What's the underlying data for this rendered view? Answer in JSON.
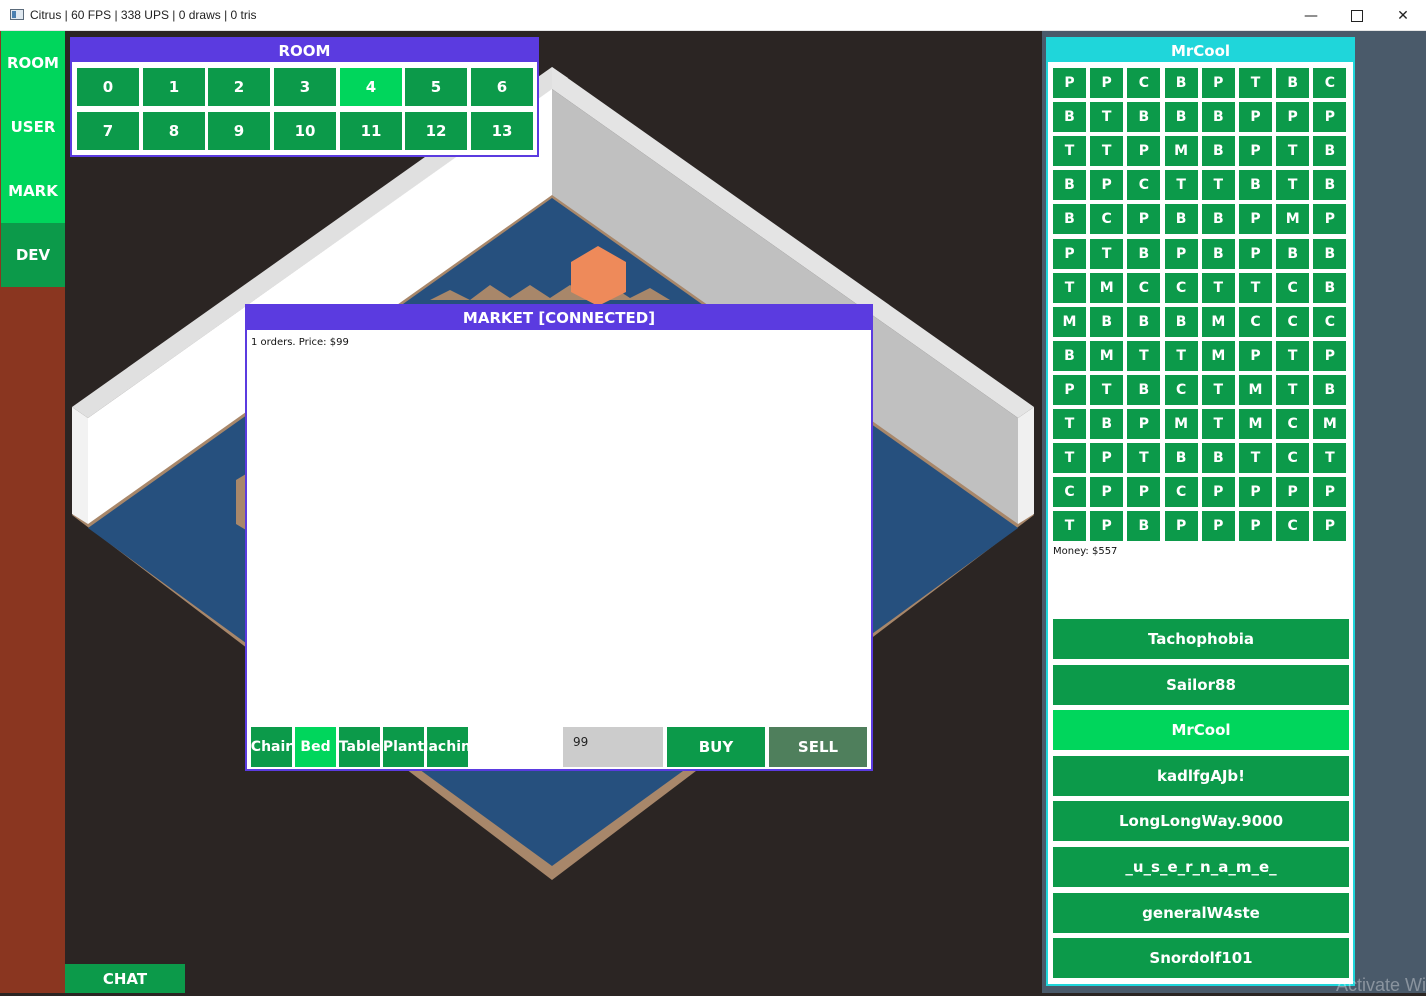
{
  "window": {
    "title": "Citrus | 60 FPS | 338 UPS | 0 draws | 0 tris"
  },
  "nav": {
    "items": [
      {
        "label": "ROOM"
      },
      {
        "label": "USER"
      },
      {
        "label": "MARK"
      },
      {
        "label": "DEV"
      }
    ]
  },
  "room": {
    "title": "ROOM",
    "buttons": [
      "0",
      "1",
      "2",
      "3",
      "4",
      "5",
      "6",
      "7",
      "8",
      "9",
      "10",
      "11",
      "12",
      "13"
    ],
    "active": "4"
  },
  "market": {
    "title": "MARKET [CONNECTED]",
    "orders_text": "1 orders. Price: $99",
    "categories": [
      "Chair",
      "Bed",
      "Table",
      "Plant",
      "Machine"
    ],
    "active_category": "Bed",
    "price_value": "99",
    "buy_label": "BUY",
    "sell_label": "SELL"
  },
  "user": {
    "title": "MrCool",
    "grid": [
      [
        "P",
        "P",
        "C",
        "B",
        "P",
        "T",
        "B",
        "C"
      ],
      [
        "B",
        "T",
        "B",
        "B",
        "B",
        "P",
        "P",
        "P"
      ],
      [
        "T",
        "T",
        "P",
        "M",
        "B",
        "P",
        "T",
        "B"
      ],
      [
        "B",
        "P",
        "C",
        "T",
        "T",
        "B",
        "T",
        "B"
      ],
      [
        "B",
        "C",
        "P",
        "B",
        "B",
        "P",
        "M",
        "P"
      ],
      [
        "P",
        "T",
        "B",
        "P",
        "B",
        "P",
        "B",
        "B"
      ],
      [
        "T",
        "M",
        "C",
        "C",
        "T",
        "T",
        "C",
        "B"
      ],
      [
        "M",
        "B",
        "B",
        "B",
        "M",
        "C",
        "C",
        "C"
      ],
      [
        "B",
        "M",
        "T",
        "T",
        "M",
        "P",
        "T",
        "P"
      ],
      [
        "P",
        "T",
        "B",
        "C",
        "T",
        "M",
        "T",
        "B"
      ],
      [
        "T",
        "B",
        "P",
        "M",
        "T",
        "M",
        "C",
        "M"
      ],
      [
        "T",
        "P",
        "T",
        "B",
        "B",
        "T",
        "C",
        "T"
      ],
      [
        "C",
        "P",
        "P",
        "C",
        "P",
        "P",
        "P",
        "P"
      ],
      [
        "T",
        "P",
        "B",
        "P",
        "P",
        "P",
        "C",
        "P"
      ]
    ],
    "money_text": "Money: $557",
    "users": [
      "Tachophobia",
      "Sailor88",
      "MrCool",
      "kadlfgAJb!",
      "LongLongWay.9000",
      "_u_s_e_r_n_a_m_e_",
      "generalW4ste",
      "Snordolf101"
    ],
    "active_user": "MrCool"
  },
  "chat": {
    "label": "CHAT"
  },
  "watermark": "Activate Windows",
  "colors": {
    "panel_purple": "#5b3be0",
    "panel_cyan": "#1fd6da",
    "button_green": "#0c9a4a",
    "active_green": "#00d65c",
    "sell_green": "#4f7f5c",
    "left_bar": "#8a3620",
    "background": "#2b2523"
  },
  "icons": {
    "app": "app-window-icon",
    "minimize": "minimize-icon",
    "maximize": "maximize-icon",
    "close": "close-icon"
  }
}
